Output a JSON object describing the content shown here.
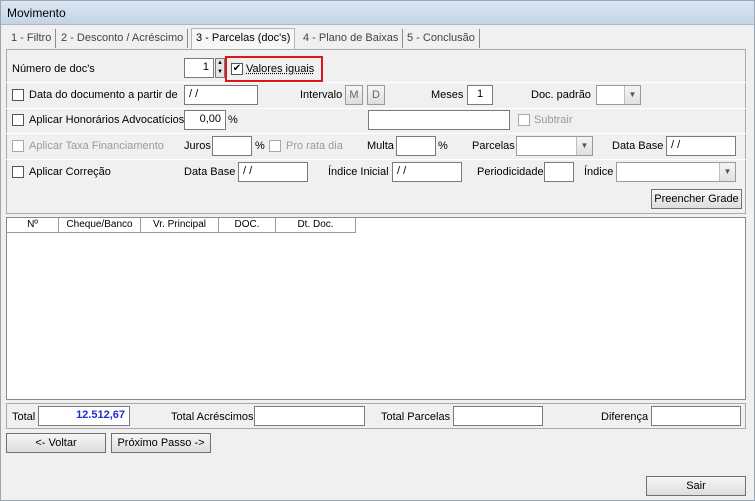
{
  "window": {
    "title": "Movimento"
  },
  "tabs": [
    {
      "label": "1 - Filtro"
    },
    {
      "label": "2 - Desconto / Acréscimo"
    },
    {
      "label": "3 - Parcelas (doc's)"
    },
    {
      "label": "4 - Plano de Baixas"
    },
    {
      "label": "5 - Conclusão"
    }
  ],
  "row1": {
    "num_docs_label": "Número de doc's",
    "num_docs_value": "1",
    "valores_iguais_label": "Valores iguais",
    "valores_iguais_checked": "✔"
  },
  "row2": {
    "data_doc_label": "Data do documento a partir de",
    "data_doc_value": " / /",
    "intervalo_label": "Intervalo",
    "m_button": "M",
    "d_button": "D",
    "meses_label": "Meses",
    "meses_value": "1",
    "doc_padrao_label": "Doc. padrão"
  },
  "row3": {
    "honorarios_label": "Aplicar Honorários Advocatícios",
    "honorarios_value": "0,00",
    "percent": "%",
    "subtrair_label": "Subtrair"
  },
  "row4": {
    "taxa_label": "Aplicar Taxa Financiamento",
    "juros_label": "Juros",
    "percent": "%",
    "pro_rata_label": "Pro rata dia",
    "multa_label": "Multa",
    "parcelas_label": "Parcelas",
    "data_base_label": "Data Base",
    "data_base_value": " / /"
  },
  "row5": {
    "correcao_label": "Aplicar Correção",
    "data_base_label": "Data Base",
    "data_base_value": " / /",
    "indice_inicial_label": "Índice Inicial",
    "indice_inicial_value": " / /",
    "periodicidade_label": "Periodicidade",
    "indice_label": "Índice"
  },
  "buttons": {
    "preencher_grade": "Preencher Grade",
    "voltar": "<- Voltar",
    "proximo": "Próximo Passo ->",
    "sair": "Sair"
  },
  "grid": {
    "columns": [
      "Nº",
      "Cheque/Banco",
      "Vr. Principal",
      "DOC.",
      "Dt. Doc."
    ]
  },
  "totals": {
    "total_label": "Total",
    "total_value": "12.512,67",
    "acrescimos_label": "Total Acréscimos",
    "parcelas_label": "Total Parcelas",
    "diferenca_label": "Diferença"
  },
  "colors": {
    "highlight": "#e0151a",
    "total_value": "#1a2fd0"
  },
  "icons": {
    "checkbox_checked": "check-icon",
    "combo_arrow": "chevron-down-icon",
    "spin": "spin-updown-icon"
  }
}
